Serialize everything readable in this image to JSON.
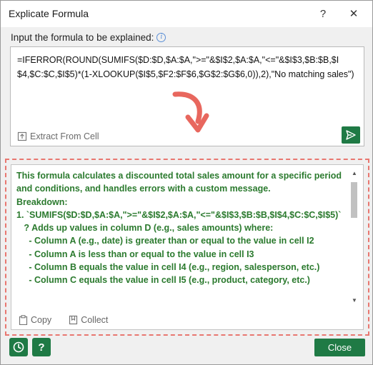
{
  "window": {
    "title": "Explicate Formula",
    "help_label": "?",
    "close_glyph": "✕"
  },
  "input": {
    "label": "Input the formula to be explained:",
    "formula": "=IFERROR(ROUND(SUMIFS($D:$D,$A:$A,\">=\"&$I$2,$A:$A,\"<=\"&$I$3,$B:$B,$I$4,$C:$C,$I$5)*(1-XLOOKUP($I$5,$F2:$F$6,$G$2:$G$6,0)),2),\"No matching sales\")",
    "extract_label": "Extract From Cell"
  },
  "explanation": {
    "lines": [
      "This formula calculates a discounted total sales amount for a specific period and conditions, and handles errors with a custom message.",
      "",
      "Breakdown:",
      "",
      "1. `SUMIFS($D:$D,$A:$A,\">=\"&$I$2,$A:$A,\"<=\"&$I$3,$B:$B,$I$4,$C:$C,$I$5)`",
      "   ? Adds up values in column D (e.g., sales amounts) where:",
      "     - Column A (e.g., date) is greater than or equal to the value in cell I2",
      "     - Column A is less than or equal to the value in cell I3",
      "     - Column B equals the value in cell I4 (e.g., region, salesperson, etc.)",
      "     - Column C equals the value in cell I5 (e.g., product, category, etc.)"
    ],
    "copy_label": "Copy",
    "collect_label": "Collect"
  },
  "footer": {
    "help_label": "?",
    "close_label": "Close"
  },
  "colors": {
    "accent": "#1f7a45",
    "explanation_text": "#2b7a2e",
    "highlight_dash": "#e87770",
    "arrow": "#e8675e"
  }
}
